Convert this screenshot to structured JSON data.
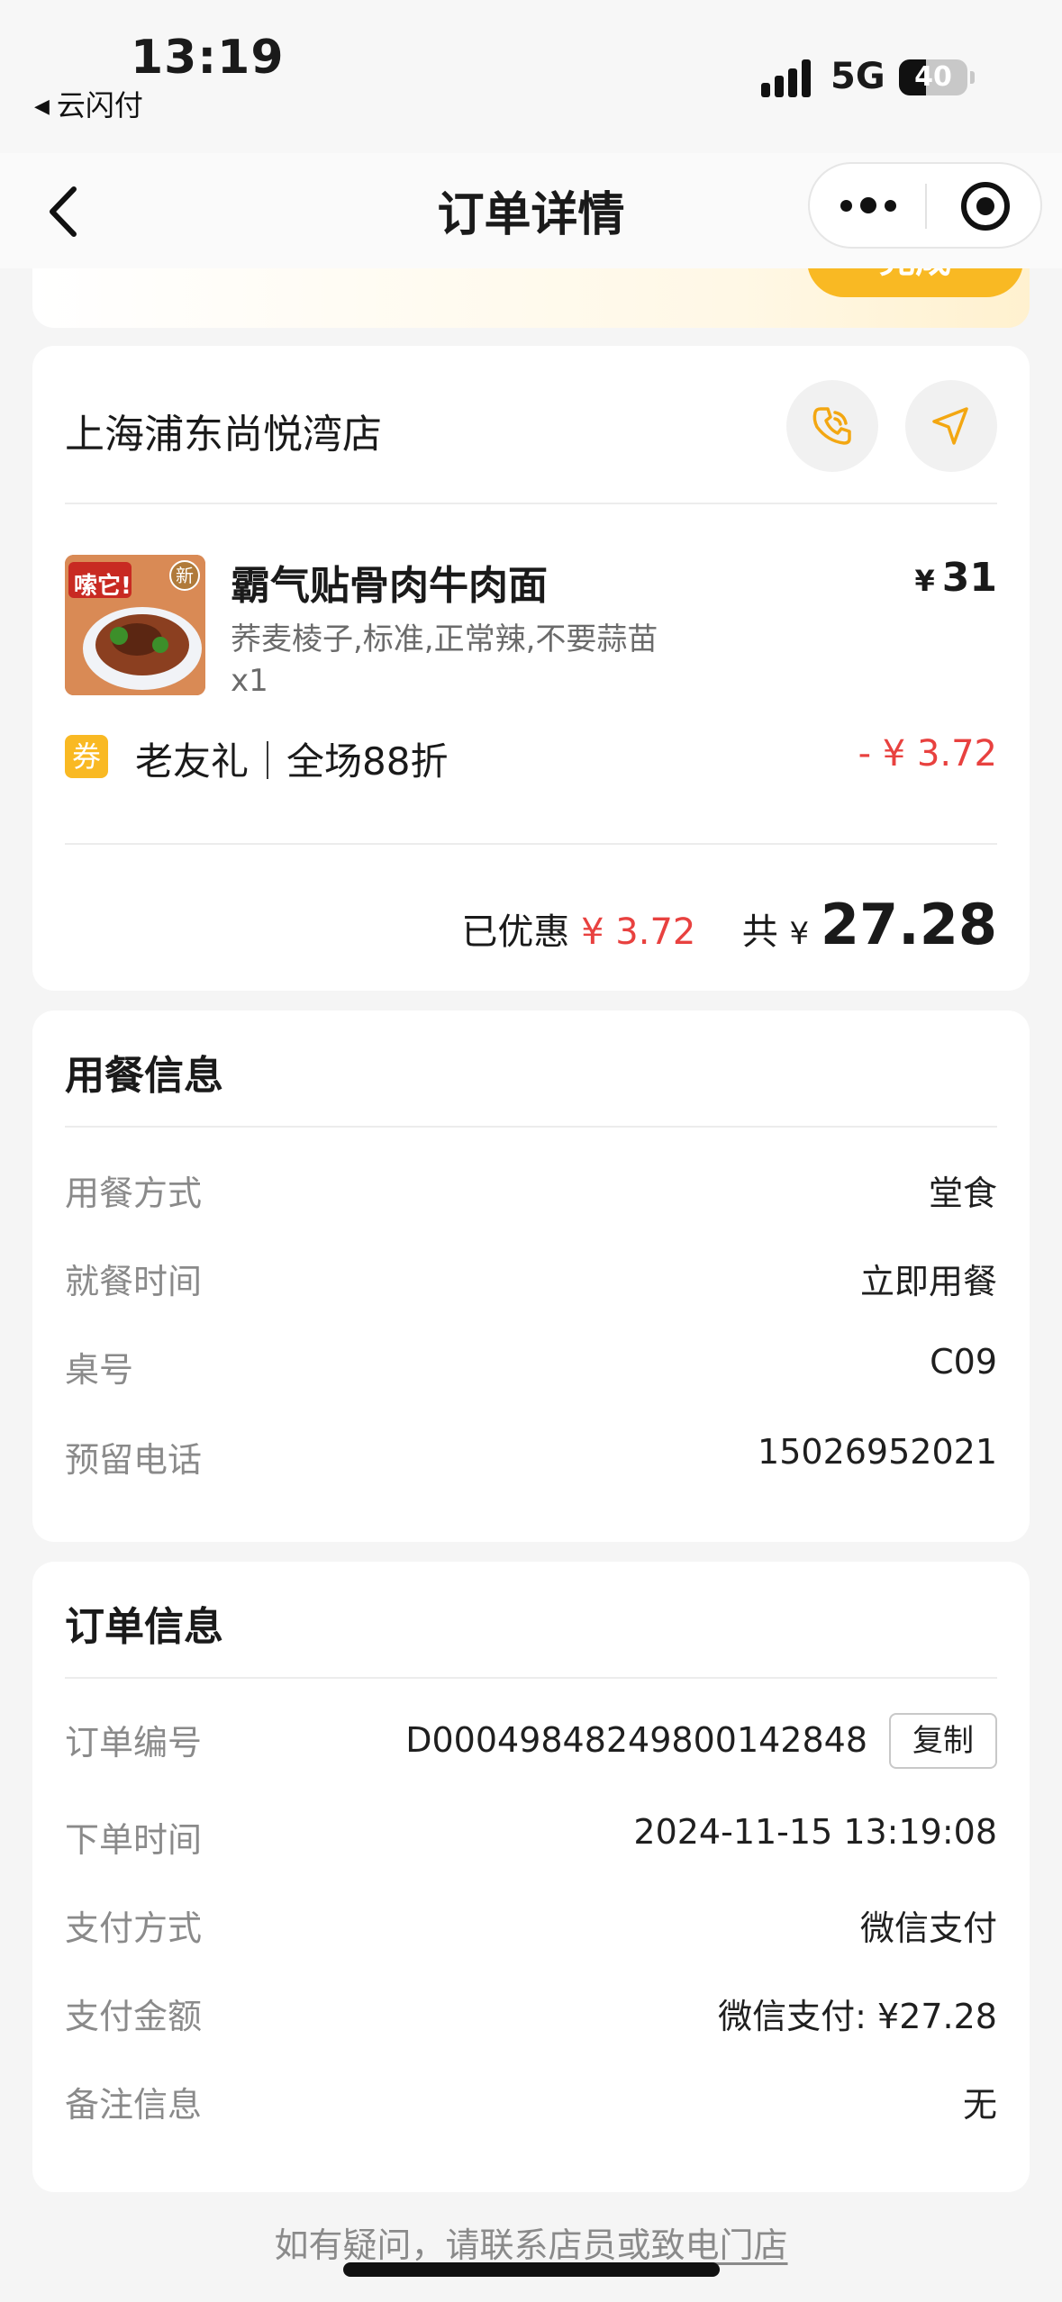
{
  "status_bar": {
    "time": "13:19",
    "back_app": "云闪付",
    "network": "5G",
    "battery": "40"
  },
  "nav": {
    "title": "订单详情"
  },
  "top_card": {
    "button_label": "完成"
  },
  "store": {
    "name": "上海浦东尚悦湾店",
    "item": {
      "name": "霸气贴骨肉牛肉面",
      "options": "荞麦棱子,标准,正常辣,不要蒜苗",
      "quantity": "x1",
      "price_symbol": "¥",
      "price": "31",
      "image_text": "嗦它!",
      "image_badge": "新"
    },
    "coupon": {
      "badge": "券",
      "label": "老友礼｜全场88折",
      "amount": "- ¥ 3.72"
    },
    "summary": {
      "discount_label": "已优惠",
      "discount_amount": "¥ 3.72",
      "total_label": "共",
      "total_symbol": "¥",
      "total_amount": "27.28"
    }
  },
  "meal_info": {
    "title": "用餐信息",
    "rows": [
      {
        "label": "用餐方式",
        "value": "堂食"
      },
      {
        "label": "就餐时间",
        "value": "立即用餐"
      },
      {
        "label": "桌号",
        "value": "C09"
      },
      {
        "label": "预留电话",
        "value": "15026952021"
      }
    ]
  },
  "order_info": {
    "title": "订单信息",
    "copy_label": "复制",
    "rows": [
      {
        "label": "订单编号",
        "value": "D0004984824980014284​8"
      },
      {
        "label": "下单时间",
        "value": "2024-11-15 13:19:08"
      },
      {
        "label": "支付方式",
        "value": "微信支付"
      },
      {
        "label": "支付金额",
        "value": "微信支付: ¥27.28"
      },
      {
        "label": "备注信息",
        "value": "无"
      }
    ]
  },
  "footer": {
    "prefix": "如有疑问，请",
    "link": "联系店员或致电门店"
  },
  "colors": {
    "accent": "#f9b923",
    "discount_red": "#e8413f"
  }
}
